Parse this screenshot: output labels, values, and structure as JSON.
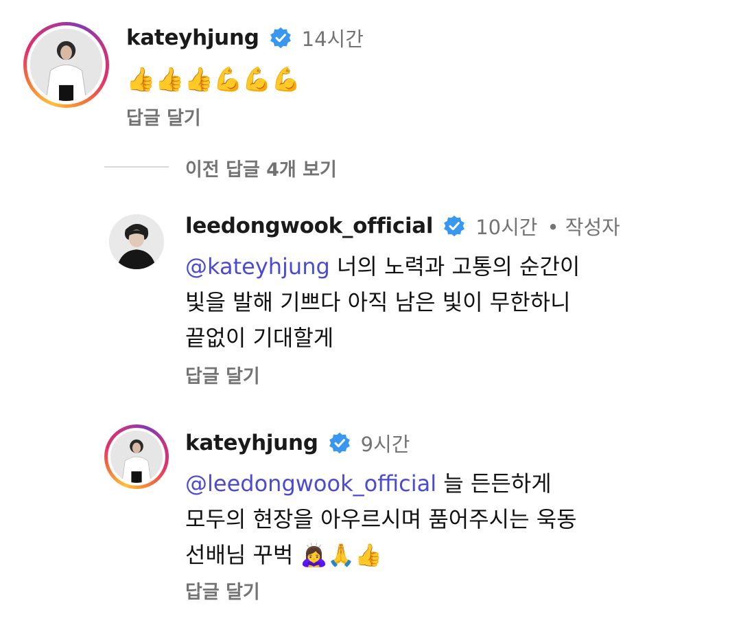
{
  "comments": [
    {
      "username": "kateyhjung",
      "time": "14시간",
      "text": "👍👍👍💪💪💪",
      "reply_label": "답글 달기"
    }
  ],
  "view_previous_replies": "이전 답글 4개 보기",
  "replies": [
    {
      "username": "leedongwook_official",
      "time": "10시간",
      "author_tag": "• 작성자",
      "mention": "@kateyhjung",
      "lines": [
        " 너의 노력과 고통의 순간이",
        "빛을 발해 기쁘다 아직 남은 빛이 무한하니",
        "끝없이 기대할게"
      ],
      "reply_label": "답글 달기"
    },
    {
      "username": "kateyhjung",
      "time": "9시간",
      "mention": "@leedongwook_official",
      "lines": [
        " 늘 든든하게",
        "모두의 현장을 아우르시며 품어주시는 욱동",
        "선배님 꾸벅 🙇‍♀️🙏👍"
      ],
      "reply_label": "답글 달기"
    }
  ],
  "colors": {
    "verified": "#3897f0",
    "mention": "#4a4ad6",
    "secondary_text": "#737373"
  }
}
